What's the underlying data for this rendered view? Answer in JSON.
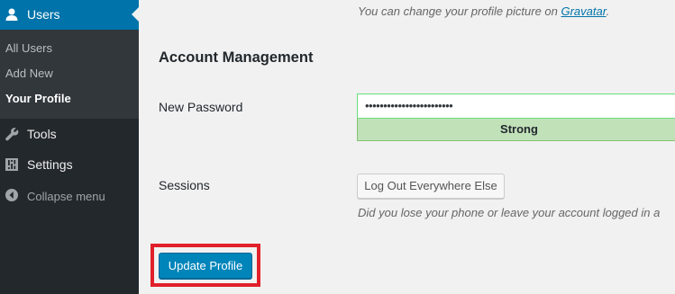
{
  "sidebar": {
    "users_label": "Users",
    "submenu": {
      "all_users": "All Users",
      "add_new": "Add New",
      "your_profile": "Your Profile"
    },
    "tools_label": "Tools",
    "settings_label": "Settings",
    "collapse_label": "Collapse menu"
  },
  "profile_picture_note": {
    "text": "You can change your profile picture on ",
    "link": "Gravatar",
    "end": "."
  },
  "account_management": {
    "title": "Account Management",
    "new_password_label": "New Password",
    "password_value": "••••••••••••••••••••••••",
    "strength": "Strong",
    "sessions_label": "Sessions",
    "logout_button": "Log Out Everywhere Else",
    "sessions_help": "Did you lose your phone or leave your account logged in a"
  },
  "update_button": "Update Profile",
  "colors": {
    "sidebar_bg": "#23282d",
    "submenu_bg": "#32373c",
    "active_menu": "#0073aa",
    "primary_button": "#0085ba",
    "strength_bg": "#c1e1b9",
    "highlight": "#e0202a"
  }
}
